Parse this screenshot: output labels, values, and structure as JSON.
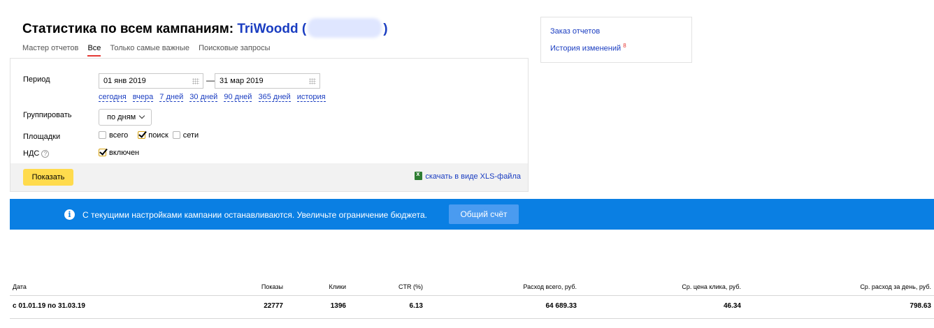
{
  "header": {
    "title_prefix": "Статистика по всем кампаниям:",
    "campaign_name": "TriWoodd",
    "open_paren": "(",
    "close_paren": ")"
  },
  "tabs": [
    {
      "label": "Мастер отчетов",
      "active": false
    },
    {
      "label": "Все",
      "active": true
    },
    {
      "label": "Только самые важные",
      "active": false
    },
    {
      "label": "Поисковые запросы",
      "active": false
    }
  ],
  "form": {
    "period_label": "Период",
    "date_from": "01 янв 2019",
    "date_to": "31 мар 2019",
    "date_separator": "—",
    "quick_ranges": [
      "сегодня",
      "вчера",
      "7 дней",
      "30 дней",
      "90 дней",
      "365 дней",
      "история"
    ],
    "group_label": "Группировать",
    "group_value": "по дням",
    "platforms_label": "Площадки",
    "platforms": [
      {
        "label": "всего",
        "checked": false
      },
      {
        "label": "поиск",
        "checked": true
      },
      {
        "label": "сети",
        "checked": false
      }
    ],
    "vat_label": "НДС",
    "vat_help": "?",
    "vat_option": {
      "label": "включен",
      "checked": true
    },
    "show_button": "Показать",
    "xls_link": "скачать в виде XLS-файла"
  },
  "side_links": {
    "order_reports": "Заказ отчетов",
    "change_history": "История изменений",
    "history_badge": "8"
  },
  "banner": {
    "icon": "info-icon",
    "text": "С текущими настройками кампании останавливаются. Увеличьте ограничение бюджета.",
    "button": "Общий счёт",
    "color": "#0a7fe3"
  },
  "table": {
    "headers": [
      "Дата",
      "Показы",
      "Клики",
      "CTR (%)",
      "Расход всего, руб.",
      "Ср. цена клика, руб.",
      "Ср. расход за день, руб."
    ],
    "rows": [
      [
        "с 01.01.19 по 31.03.19",
        "22777",
        "1396",
        "6.13",
        "64 689.33",
        "46.34",
        "798.63"
      ]
    ]
  },
  "colors": {
    "link": "#1a3dc1",
    "accent_yellow": "#ffdb4d",
    "active_tab_underline": "#e53935"
  }
}
